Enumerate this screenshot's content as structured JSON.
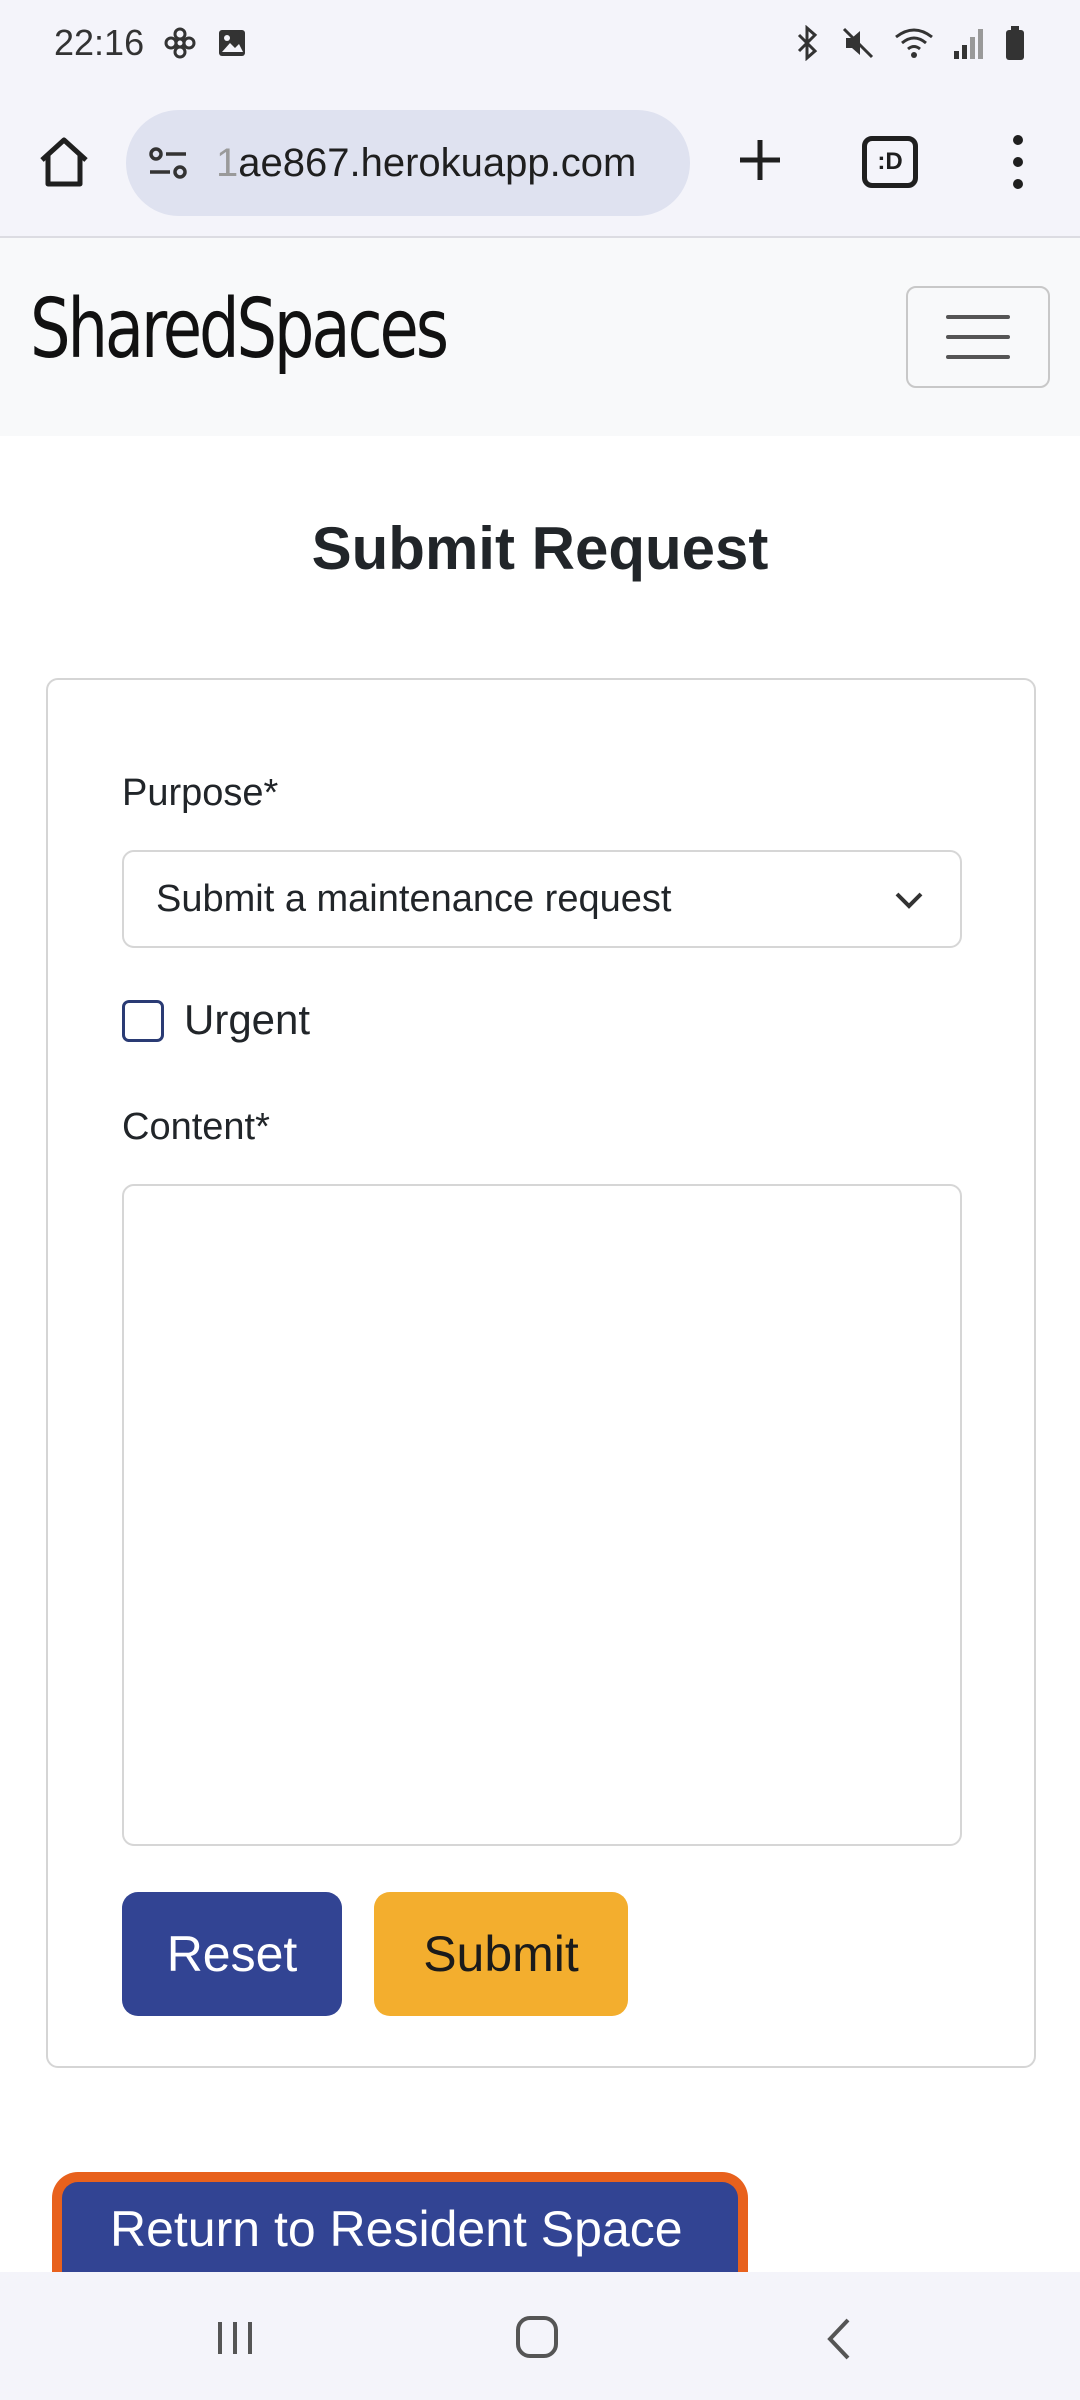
{
  "status_bar": {
    "time": "22:16",
    "left_icons": [
      "flower-icon",
      "image-icon"
    ],
    "right_icons": [
      "bluetooth-icon",
      "mute-icon",
      "wifi-icon",
      "signal-icon",
      "battery-icon"
    ]
  },
  "browser": {
    "url_prefix": "1",
    "url": "ae867.herokuapp.com",
    "tab_label": ":D",
    "icons": [
      "home-icon",
      "site-info-icon",
      "plus-icon",
      "tabs-icon",
      "more-vert-icon"
    ]
  },
  "navbar": {
    "brand": "SharedSpaces",
    "toggler_icon": "hamburger-icon"
  },
  "page": {
    "title": "Submit Request"
  },
  "form": {
    "purpose_label": "Purpose*",
    "purpose_selected": "Submit a maintenance request",
    "urgent_label": "Urgent",
    "urgent_checked": false,
    "content_label": "Content*",
    "content_value": "",
    "reset_label": "Reset",
    "submit_label": "Submit"
  },
  "footer_link": {
    "label": "Return to Resident Space"
  },
  "colors": {
    "primary": "#324493",
    "warning": "#f3ae2e",
    "focus_outline": "#e8611d"
  },
  "system_nav": {
    "icons": [
      "recents-icon",
      "home-circle-icon",
      "back-icon"
    ]
  }
}
